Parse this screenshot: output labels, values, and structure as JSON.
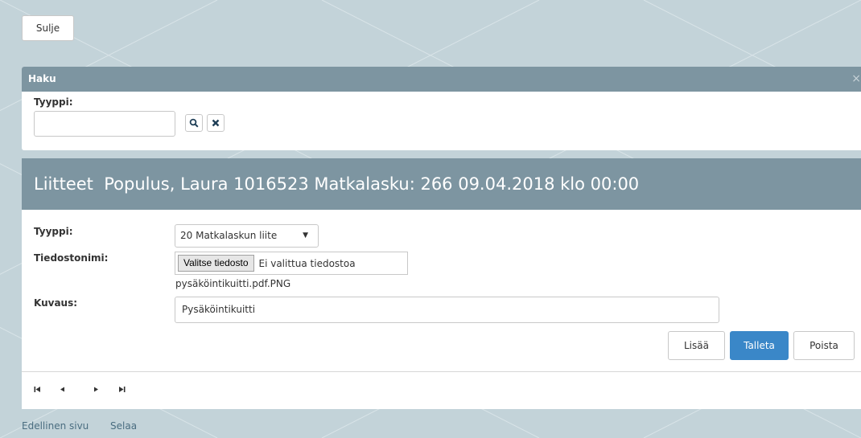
{
  "close_button": "Sulje",
  "search_panel": {
    "title": "Haku",
    "close_glyph": "×",
    "type_label": "Tyyppi:",
    "type_value": "",
    "search_icon": "search-icon",
    "clear_icon": "clear-icon"
  },
  "attachments": {
    "header": "Liitteet  Populus, Laura 1016523 Matkalasku: 266 09.04.2018 klo 00:00",
    "type_label": "Tyyppi:",
    "type_value": "20 Matkalaskun liite",
    "filename_label": "Tiedostonimi:",
    "file_button": "Valitse tiedosto",
    "file_status": "Ei valittua tiedostoa",
    "current_file": "pysäköintikuitti.pdf.PNG",
    "description_label": "Kuvaus:",
    "description_value": "Pysäköintikuitti",
    "add_button": "Lisää",
    "save_button": "Talleta",
    "delete_button": "Poista"
  },
  "pager": {
    "first": "first-page-icon",
    "prev": "prev-page-icon",
    "next": "next-page-icon",
    "last": "last-page-icon"
  },
  "footer_links": {
    "previous_page": "Edellinen sivu",
    "browse": "Selaa"
  },
  "colors": {
    "background": "#c3d3d9",
    "panel_header": "#7d95a1",
    "primary": "#3a87c8",
    "link": "#4a6d80"
  }
}
